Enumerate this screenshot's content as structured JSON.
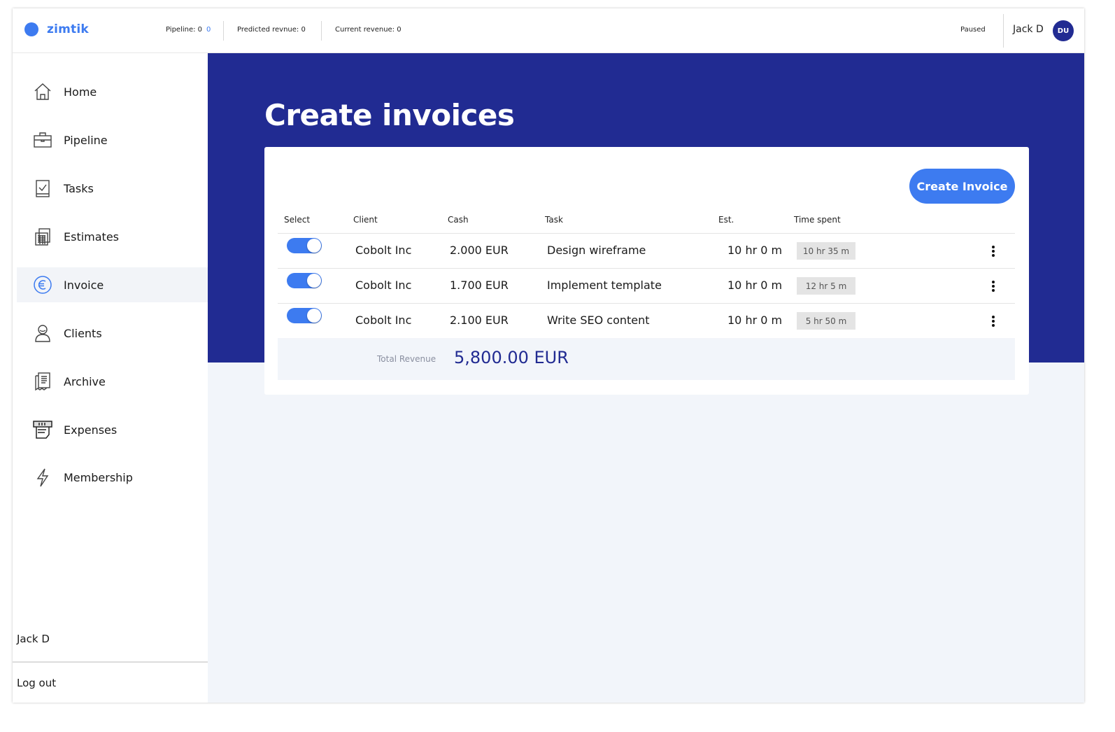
{
  "app": {
    "logo_text": "zimtik",
    "brand_color": "#3d7bf0",
    "hero_color": "#212b92"
  },
  "header": {
    "pipeline_label": "Pipeline: 0",
    "pipeline_value": "0",
    "predicted_label": "Predicted revnue: 0",
    "current_label": "Current revenue: 0",
    "status": "Paused",
    "user_name": "Jack D",
    "avatar_initials": "DU"
  },
  "sidebar": {
    "items": [
      {
        "label": "Home",
        "icon": "home-icon"
      },
      {
        "label": "Pipeline",
        "icon": "briefcase-icon"
      },
      {
        "label": "Tasks",
        "icon": "checklist-icon"
      },
      {
        "label": "Estimates",
        "icon": "calculator-icon"
      },
      {
        "label": "Invoice",
        "icon": "euro-icon",
        "active": true
      },
      {
        "label": "Clients",
        "icon": "person-icon"
      },
      {
        "label": "Archive",
        "icon": "archive-icon"
      },
      {
        "label": "Expenses",
        "icon": "expenses-icon"
      },
      {
        "label": "Membership",
        "icon": "lightning-icon"
      }
    ],
    "user_name": "Jack D",
    "logout_label": "Log out"
  },
  "main": {
    "title": "Create invoices",
    "create_button": "Create Invoice",
    "columns": [
      "Select",
      "Client",
      "Cash",
      "Task",
      "Est.",
      "Time spent"
    ],
    "rows": [
      {
        "selected": true,
        "client": "Cobolt Inc",
        "cash": "2.000 EUR",
        "task": "Design wireframe",
        "est": "10 hr 0 m",
        "spent": "10 hr 35 m"
      },
      {
        "selected": true,
        "client": "Cobolt Inc",
        "cash": "1.700 EUR",
        "task": "Implement template",
        "est": "10 hr 0 m",
        "spent": "12 hr 5 m"
      },
      {
        "selected": true,
        "client": "Cobolt Inc",
        "cash": "2.100 EUR",
        "task": "Write SEO content",
        "est": "10 hr 0 m",
        "spent": "5 hr 50 m"
      }
    ],
    "total_label": "Total Revenue",
    "total_value": "5,800.00 EUR"
  }
}
